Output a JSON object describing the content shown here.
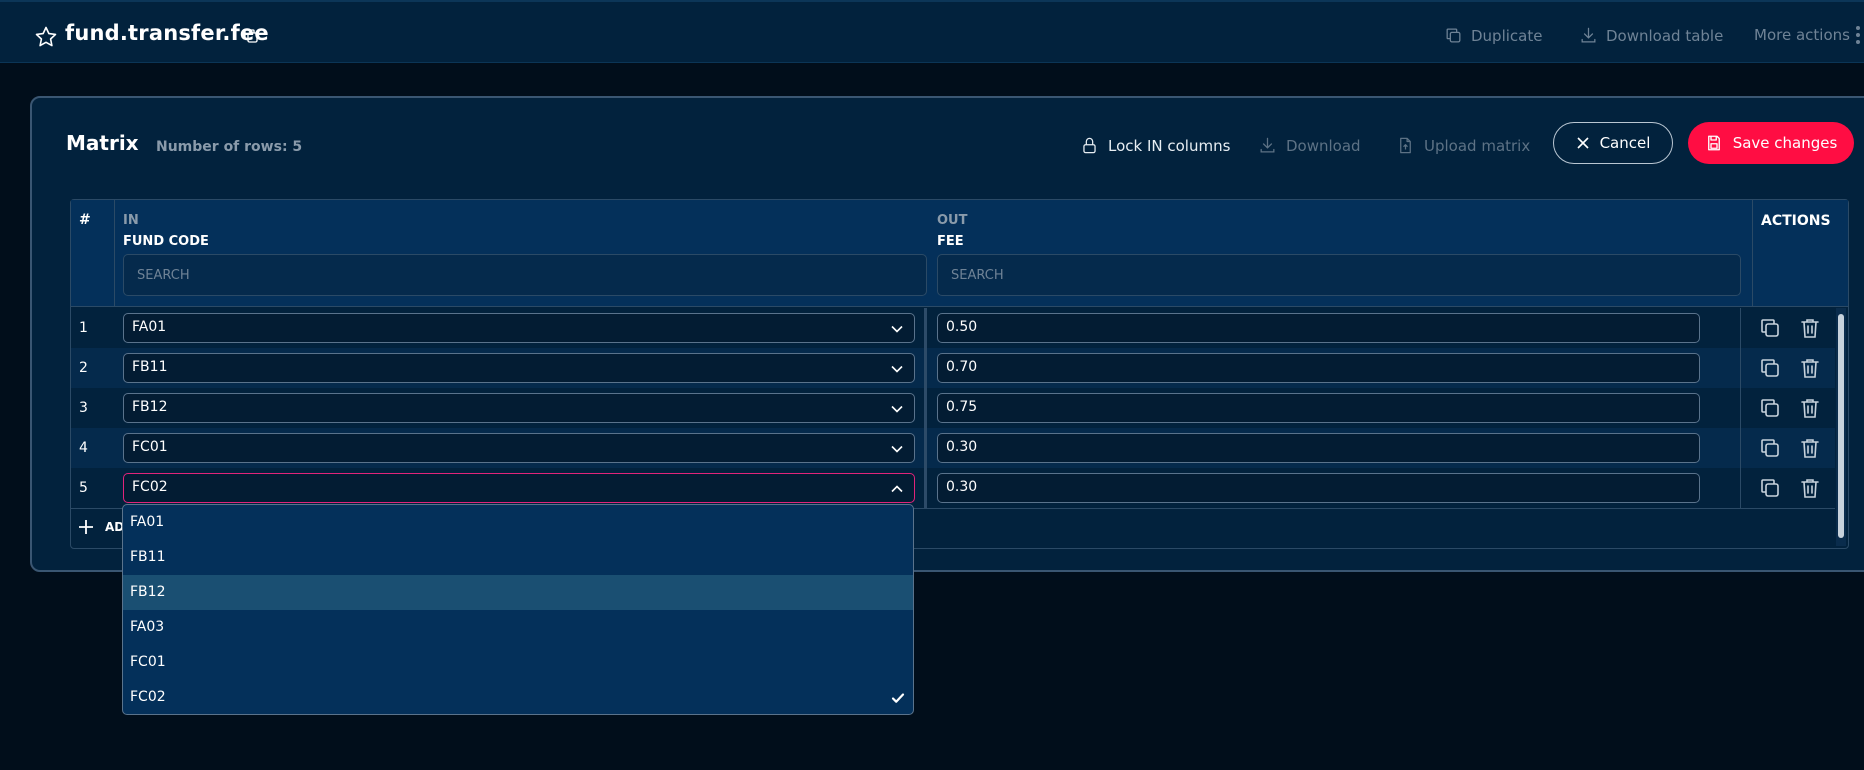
{
  "header": {
    "title": "fund.transfer.fee",
    "actions": {
      "duplicate": "Duplicate",
      "download_table": "Download table",
      "more_actions": "More actions"
    }
  },
  "panel": {
    "title": "Matrix",
    "row_count": "Number of rows: 5",
    "actions": {
      "lock": "Lock IN columns",
      "download": "Download",
      "upload": "Upload matrix"
    },
    "cancel": "Cancel",
    "save": "Save changes"
  },
  "table": {
    "hash": "#",
    "in_group": "IN",
    "in_col": "FUND CODE",
    "out_group": "OUT",
    "out_col": "FEE",
    "search_placeholder": "SEARCH",
    "actions_header": "ACTIONS",
    "rows": [
      {
        "num": "1",
        "fund_code": "FA01",
        "fee": "0.50"
      },
      {
        "num": "2",
        "fund_code": "FB11",
        "fee": "0.70"
      },
      {
        "num": "3",
        "fund_code": "FB12",
        "fee": "0.75"
      },
      {
        "num": "4",
        "fund_code": "FC01",
        "fee": "0.30"
      },
      {
        "num": "5",
        "fund_code": "FC02",
        "fee": "0.30"
      }
    ],
    "add_row": "ADD ROW"
  },
  "dropdown": {
    "options": [
      "FA01",
      "FB11",
      "FB12",
      "FA03",
      "FC01",
      "FC02"
    ],
    "highlighted": "FB12",
    "selected": "FC02"
  }
}
